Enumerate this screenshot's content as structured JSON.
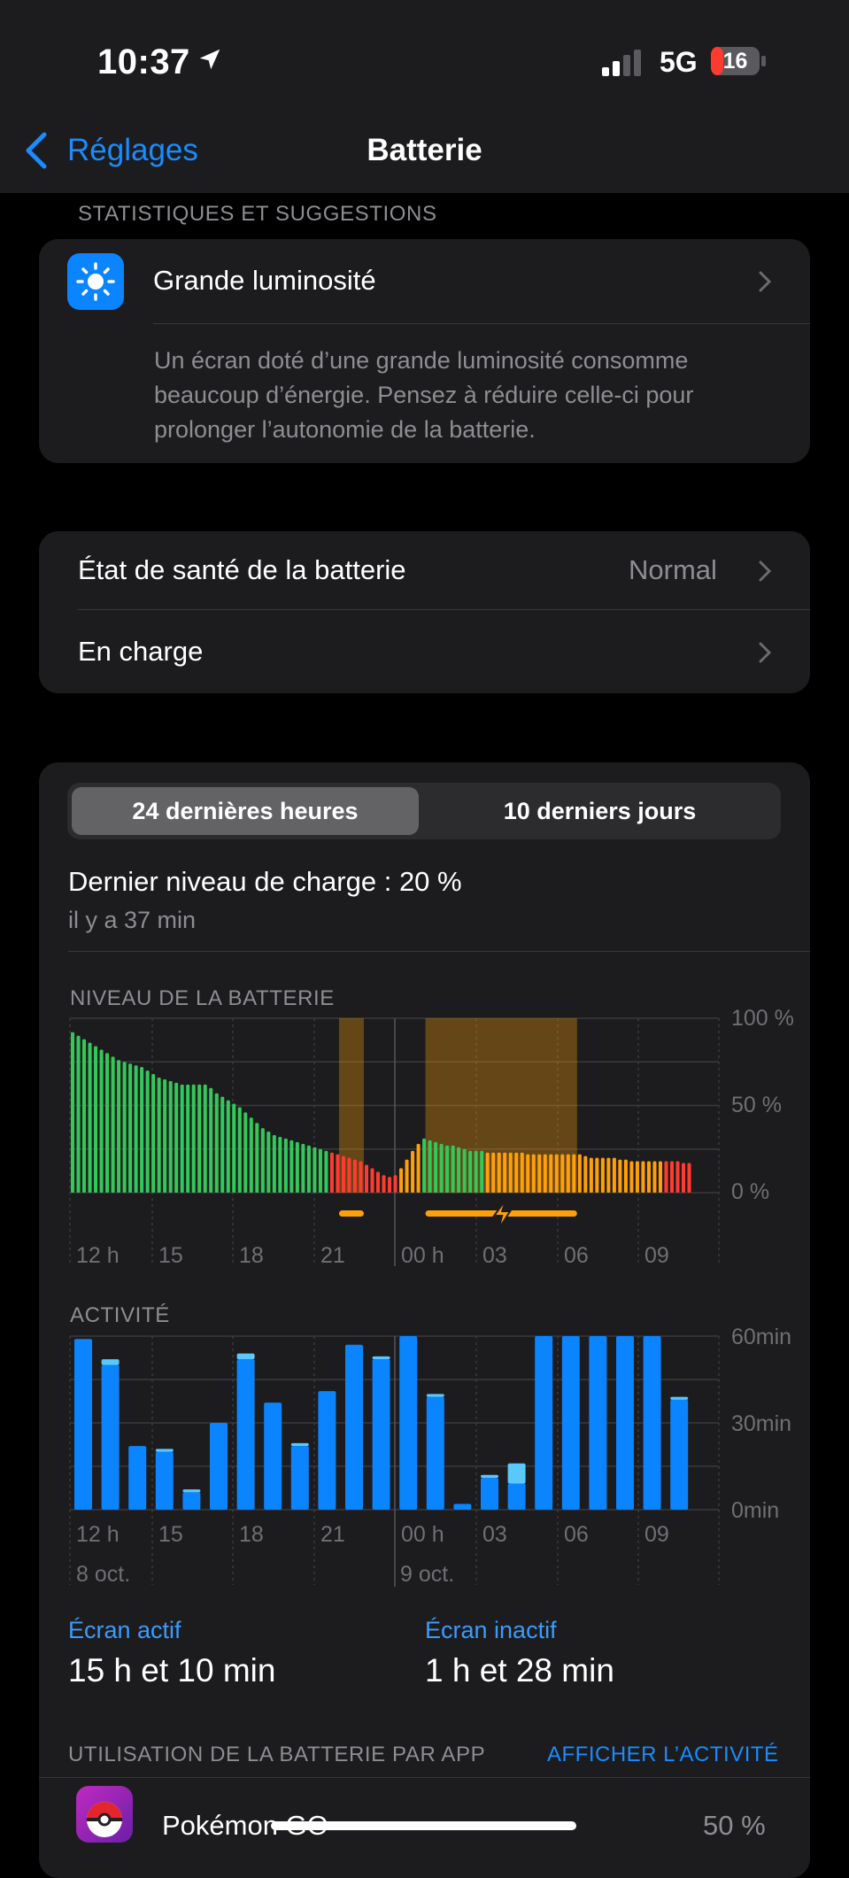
{
  "status_bar": {
    "time": "10:37",
    "network": "5G",
    "battery_level": "16"
  },
  "nav": {
    "back_label": "Réglages",
    "title": "Batterie"
  },
  "suggestions": {
    "header": "STATISTIQUES ET SUGGESTIONS",
    "title": "Grande luminosité",
    "description_lines": [
      "Un écran doté d’une grande luminosité consomme",
      "beaucoup d’énergie. Pensez à réduire celle-ci pour",
      "prolonger l’autonomie de la batterie."
    ]
  },
  "health": {
    "row1_label": "État de santé de la batterie",
    "row1_value": "Normal",
    "row2_label": "En charge"
  },
  "usage": {
    "tab_active": "24 dernières heures",
    "tab_inactive": "10 derniers jours",
    "last_charge": "Dernier niveau de charge : 20 %",
    "last_charge_time": "il y a 37 min",
    "screen_on_label": "Écran actif",
    "screen_on_value": "15 h et 10 min",
    "screen_off_label": "Écran inactif",
    "screen_off_value": "1 h et 28 min",
    "apps_header": "UTILISATION DE LA BATTERIE PAR APP",
    "apps_link": "AFFICHER L’ACTIVITÉ",
    "apps": [
      {
        "name": "Pokémon GO",
        "percent": "50 %"
      }
    ]
  },
  "colors": {
    "green": "#34c759",
    "red": "#ff3b30",
    "orange": "#ff9f0a",
    "blue": "#0a84ff",
    "light_blue": "#5ac8fa"
  },
  "chart_data": [
    {
      "type": "bar",
      "title": "NIVEAU DE LA BATTERIE",
      "ylabels": [
        "100 %",
        "50 %",
        "0 %"
      ],
      "ylim": [
        0,
        100
      ],
      "xlabels": [
        "12 h",
        "15",
        "18",
        "21",
        "00 h",
        "03",
        "06",
        "09"
      ],
      "charging_ranges": [
        [
          47,
          50
        ],
        [
          62,
          87
        ]
      ],
      "values": [
        92,
        90,
        88,
        86,
        84,
        82,
        80,
        78,
        76,
        75,
        74,
        73,
        72,
        70,
        68,
        66,
        65,
        64,
        63,
        62,
        62,
        62,
        62,
        62,
        60,
        57,
        55,
        53,
        51,
        49,
        46,
        43,
        40,
        37,
        35,
        33,
        32,
        31,
        30,
        29,
        28,
        27,
        26,
        25,
        24,
        23,
        22,
        21,
        20,
        19,
        18,
        16,
        14,
        12,
        10,
        9,
        10,
        14,
        19,
        24,
        28,
        31,
        30,
        29,
        28,
        27,
        27,
        26,
        25,
        24,
        24,
        24,
        23,
        23,
        23,
        23,
        23,
        23,
        23,
        22,
        22,
        22,
        22,
        22,
        22,
        22,
        22,
        22,
        22,
        21,
        20,
        20,
        20,
        20,
        20,
        19,
        19,
        18,
        18,
        18,
        18,
        18,
        18,
        18,
        18,
        18,
        17,
        17
      ],
      "bar_colors": [
        "green",
        "green",
        "green",
        "green",
        "green",
        "green",
        "green",
        "green",
        "green",
        "green",
        "green",
        "green",
        "green",
        "green",
        "green",
        "green",
        "green",
        "green",
        "green",
        "green",
        "green",
        "green",
        "green",
        "green",
        "green",
        "green",
        "green",
        "green",
        "green",
        "green",
        "green",
        "green",
        "green",
        "green",
        "green",
        "green",
        "green",
        "green",
        "green",
        "green",
        "green",
        "green",
        "green",
        "green",
        "green",
        "red",
        "red",
        "red",
        "red",
        "red",
        "red",
        "red",
        "red",
        "red",
        "red",
        "red",
        "red",
        "orange",
        "orange",
        "orange",
        "orange",
        "green",
        "green",
        "green",
        "green",
        "green",
        "green",
        "green",
        "green",
        "green",
        "green",
        "green",
        "orange",
        "orange",
        "orange",
        "orange",
        "orange",
        "orange",
        "orange",
        "orange",
        "orange",
        "orange",
        "orange",
        "orange",
        "orange",
        "orange",
        "orange",
        "orange",
        "orange",
        "orange",
        "orange",
        "orange",
        "orange",
        "orange",
        "orange",
        "orange",
        "orange",
        "orange",
        "orange",
        "orange",
        "orange",
        "orange",
        "orange",
        "red",
        "red",
        "red",
        "red",
        "red",
        "red",
        "red",
        "red"
      ]
    },
    {
      "type": "bar",
      "title": "ACTIVITÉ",
      "ylabels": [
        "60min",
        "30min",
        "0min"
      ],
      "ylim": [
        0,
        60
      ],
      "xlabels": [
        "12 h",
        "15",
        "18",
        "21",
        "00 h",
        "03",
        "06",
        "09"
      ],
      "date_labels": [
        "8 oct.",
        "9 oct."
      ],
      "series": [
        {
          "name": "Écran actif",
          "values": [
            59,
            50,
            22,
            20,
            6,
            30,
            52,
            37,
            22,
            41,
            57,
            52,
            60,
            39,
            2,
            11,
            9,
            60,
            60,
            60,
            60,
            60,
            38
          ]
        },
        {
          "name": "Écran inactif",
          "values": [
            0,
            2,
            0,
            1,
            1,
            0,
            2,
            0,
            1,
            0,
            0,
            1,
            0,
            1,
            0,
            1,
            7,
            0,
            0,
            0,
            0,
            0,
            1
          ]
        }
      ]
    }
  ]
}
